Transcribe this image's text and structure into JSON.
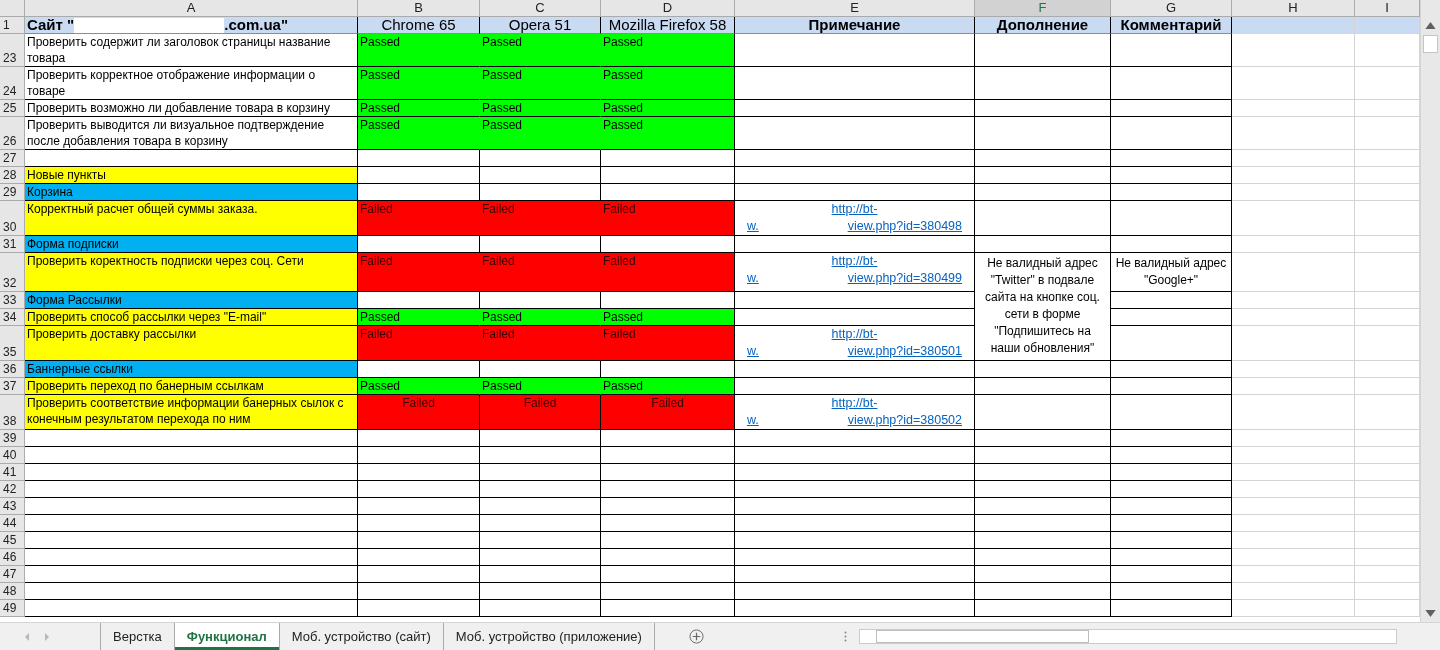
{
  "columns": [
    {
      "label": "A",
      "selected": false
    },
    {
      "label": "B",
      "selected": false
    },
    {
      "label": "C",
      "selected": false
    },
    {
      "label": "D",
      "selected": false
    },
    {
      "label": "E",
      "selected": false
    },
    {
      "label": "F",
      "selected": true
    },
    {
      "label": "G",
      "selected": false
    },
    {
      "label": "H",
      "selected": false
    },
    {
      "label": "I",
      "selected": false
    }
  ],
  "header_row": {
    "number": "1",
    "title_start": "Сайт \"",
    "title_end": ".com.ua\"",
    "cells": [
      {
        "text": "Chrome 65",
        "bold": false
      },
      {
        "text": "Opera  51",
        "bold": false
      },
      {
        "text": "Mozilla Firefox 58",
        "bold": false
      },
      {
        "text": "Примечание",
        "bold": true
      },
      {
        "text": "Дополнение",
        "bold": true
      },
      {
        "text": "Комментарий",
        "bold": true
      }
    ]
  },
  "rows": [
    {
      "number": "23",
      "task": "Проверить содержит ли заголовок страницы название товара",
      "color": "#ffffff",
      "results": [
        {
          "text": "Passed",
          "color": "#00ff00",
          "centered": false
        },
        {
          "text": "Passed",
          "color": "#00ff00",
          "centered": false
        },
        {
          "text": "Passed",
          "color": "#00ff00",
          "centered": false
        }
      ]
    },
    {
      "number": "24",
      "task": "Проверить корректное отображение информации о товаре",
      "color": "#ffffff",
      "results": [
        {
          "text": "Passed",
          "color": "#00ff00",
          "centered": false
        },
        {
          "text": "Passed",
          "color": "#00ff00",
          "centered": false
        },
        {
          "text": "Passed",
          "color": "#00ff00",
          "centered": false
        }
      ]
    },
    {
      "number": "25",
      "task": "Проверить возможно ли добавление товара в корзину",
      "color": "#ffffff",
      "results": [
        {
          "text": "Passed",
          "color": "#00ff00",
          "centered": false
        },
        {
          "text": "Passed",
          "color": "#00ff00",
          "centered": false
        },
        {
          "text": "Passed",
          "color": "#00ff00",
          "centered": false
        }
      ]
    },
    {
      "number": "26",
      "task": "Проверить выводится ли визуальное подтверждение после добавления товара в корзину",
      "color": "#ffffff",
      "results": [
        {
          "text": "Passed",
          "color": "#00ff00",
          "centered": false
        },
        {
          "text": "Passed",
          "color": "#00ff00",
          "centered": false
        },
        {
          "text": "Passed",
          "color": "#00ff00",
          "centered": false
        }
      ]
    },
    {
      "number": "27",
      "color": "#ffffff"
    },
    {
      "number": "28",
      "task": "Новые пункты",
      "color": "#ffff00"
    },
    {
      "number": "29",
      "task": "Корзина",
      "color": "#00b0f0"
    },
    {
      "number": "30",
      "task": "Корректный расчет общей суммы заказа.",
      "color": "#ffff00",
      "results": [
        {
          "text": "Failed",
          "color": "#ff0000",
          "centered": false
        },
        {
          "text": "Failed",
          "color": "#ff0000",
          "centered": false
        },
        {
          "text": "Failed",
          "color": "#ff0000",
          "centered": false
        }
      ],
      "link": {
        "line1": "http://bt-",
        "line2_start": "w.",
        "line2_end": "view.php?id=380498"
      }
    },
    {
      "number": "31",
      "task": "Форма подписки",
      "color": "#00b0f0"
    },
    {
      "number": "32",
      "task": "Проверить коректность подписки через соц. Сети",
      "color": "#ffff00",
      "results": [
        {
          "text": "Failed",
          "color": "#ff0000",
          "centered": false
        },
        {
          "text": "Failed",
          "color": "#ff0000",
          "centered": false
        },
        {
          "text": "Failed",
          "color": "#ff0000",
          "centered": false
        }
      ],
      "link": {
        "line1": "http://bt-",
        "line2_start": "w.",
        "line2_end": "view.php?id=380499"
      },
      "addition": "Не валидный адрес \"Twitter\" в подвале сайта на кнопке соц. сети в форме \"Подпишитесь на наши обновления\"",
      "comment": "Не валидный адрес \"Google+\""
    },
    {
      "number": "33",
      "task": "Форма Рассылки",
      "color": "#00b0f0",
      "addition_merged": true
    },
    {
      "number": "34",
      "task": "Проверить способ рассылки через \"E-mail\"",
      "color": "#ffff00",
      "results": [
        {
          "text": "Passed",
          "color": "#00ff00",
          "centered": false
        },
        {
          "text": "Passed",
          "color": "#00ff00",
          "centered": false
        },
        {
          "text": "Passed",
          "color": "#00ff00",
          "centered": false
        }
      ],
      "addition_merged": true
    },
    {
      "number": "35",
      "task": "Проверить доставку рассылки",
      "color": "#ffff00",
      "results": [
        {
          "text": "Failed",
          "color": "#ff0000",
          "centered": false
        },
        {
          "text": "Failed",
          "color": "#ff0000",
          "centered": false
        },
        {
          "text": "Failed",
          "color": "#ff0000",
          "centered": false
        }
      ],
      "link": {
        "line1": "http://bt-",
        "line2_start": "w.",
        "line2_end": "view.php?id=380501"
      },
      "addition_merged": true
    },
    {
      "number": "36",
      "task": "Баннерные ссылки",
      "color": "#00b0f0"
    },
    {
      "number": "37",
      "task": "Проверить переход по банерным ссылкам",
      "color": "#ffff00",
      "results": [
        {
          "text": "Passed",
          "color": "#00ff00",
          "centered": false
        },
        {
          "text": "Passed",
          "color": "#00ff00",
          "centered": false
        },
        {
          "text": "Passed",
          "color": "#00ff00",
          "centered": false
        }
      ]
    },
    {
      "number": "38",
      "task": "Проверить соответствие информации банерных сылок с конечным результатом перехода по ним",
      "color": "#ffff00",
      "results": [
        {
          "text": "Failed",
          "color": "#ff0000",
          "centered": true
        },
        {
          "text": "Failed",
          "color": "#ff0000",
          "centered": true
        },
        {
          "text": "Failed",
          "color": "#ff0000",
          "centered": true
        }
      ],
      "link": {
        "line1": "http://bt-",
        "line2_start": "w.",
        "line2_end": "view.php?id=380502"
      }
    },
    {
      "number": "39",
      "color": "#ffffff"
    },
    {
      "number": "40",
      "color": "#ffffff"
    },
    {
      "number": "41",
      "color": "#ffffff"
    },
    {
      "number": "42",
      "color": "#ffffff"
    },
    {
      "number": "43",
      "color": "#ffffff"
    },
    {
      "number": "44",
      "color": "#ffffff"
    },
    {
      "number": "45",
      "color": "#ffffff"
    },
    {
      "number": "46",
      "color": "#ffffff"
    },
    {
      "number": "47",
      "color": "#ffffff"
    },
    {
      "number": "48",
      "color": "#ffffff"
    },
    {
      "number": "49",
      "color": "#ffffff"
    }
  ],
  "sheet_tabs": [
    {
      "label": "Верстка",
      "selected": false
    },
    {
      "label": "Функционал",
      "selected": true
    },
    {
      "label": "Моб. устройство (сайт)",
      "selected": false
    },
    {
      "label": "Моб. устройство (приложение)",
      "selected": false
    }
  ]
}
